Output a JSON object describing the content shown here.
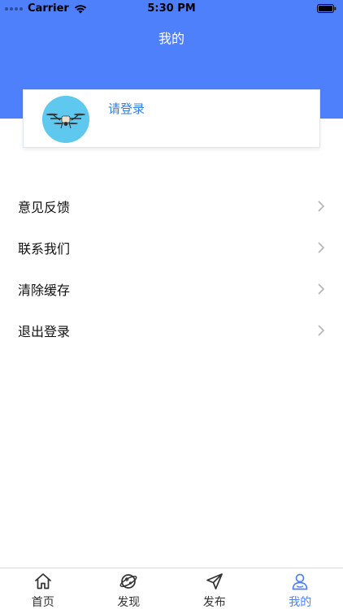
{
  "status_bar": {
    "carrier": "Carrier",
    "time": "5:30 PM"
  },
  "header": {
    "title": "我的",
    "color": "#4f80fb"
  },
  "profile": {
    "login_text": "请登录",
    "avatar_icon": "drone-avatar",
    "link_color": "#2f7fe2"
  },
  "menu": {
    "items": [
      {
        "label": "意见反馈",
        "icon": "chevron-right-icon"
      },
      {
        "label": "联系我们",
        "icon": "chevron-right-icon"
      },
      {
        "label": "清除缓存",
        "icon": "chevron-right-icon"
      },
      {
        "label": "退出登录",
        "icon": "chevron-right-icon"
      }
    ]
  },
  "tabbar": {
    "active_color": "#4f80fb",
    "tabs": [
      {
        "label": "首页",
        "icon": "home-icon",
        "active": false
      },
      {
        "label": "发现",
        "icon": "planet-icon",
        "active": false
      },
      {
        "label": "发布",
        "icon": "send-icon",
        "active": false
      },
      {
        "label": "我的",
        "icon": "user-icon",
        "active": true
      }
    ]
  }
}
